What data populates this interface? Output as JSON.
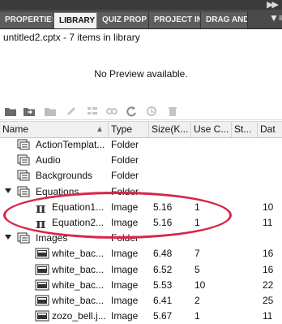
{
  "tabs": [
    {
      "label": "PROPERTIES",
      "active": false
    },
    {
      "label": "LIBRARY",
      "active": true
    },
    {
      "label": "QUIZ PROPERTIES",
      "active": false
    },
    {
      "label": "PROJECT INFO",
      "active": false
    },
    {
      "label": "DRAG AND DROP",
      "active": false
    }
  ],
  "tabs_display": [
    "PROPERTIES",
    "LIBRARY",
    "QUIZ PROP",
    "PROJECT IN",
    "DRAG AND"
  ],
  "info_line": "untitled2.cptx - 7 items in library",
  "preview_text": "No Preview available.",
  "columns": [
    "Name",
    "Type",
    "Size(K...",
    "Use C...",
    "St...",
    "Dat"
  ],
  "rows": [
    {
      "name": "ActionTemplat...",
      "type": "Folder",
      "size": "",
      "use": "",
      "st": "",
      "dat": "",
      "indent": 1,
      "icon": "folder-icon",
      "expanded": false
    },
    {
      "name": "Audio",
      "type": "Folder",
      "size": "",
      "use": "",
      "st": "",
      "dat": "",
      "indent": 1,
      "icon": "folder-icon",
      "expanded": false
    },
    {
      "name": "Backgrounds",
      "type": "Folder",
      "size": "",
      "use": "",
      "st": "",
      "dat": "",
      "indent": 1,
      "icon": "folder-icon",
      "expanded": false
    },
    {
      "name": "Equations",
      "type": "Folder",
      "size": "",
      "use": "",
      "st": "",
      "dat": "",
      "indent": 0,
      "icon": "folder-icon",
      "expanded": true
    },
    {
      "name": "Equation1...",
      "type": "Image",
      "size": "5.16",
      "use": "1",
      "st": "",
      "dat": "10",
      "indent": 2,
      "icon": "pi-icon"
    },
    {
      "name": "Equation2...",
      "type": "Image",
      "size": "5.16",
      "use": "1",
      "st": "",
      "dat": "11",
      "indent": 2,
      "icon": "pi-icon"
    },
    {
      "name": "Images",
      "type": "Folder",
      "size": "",
      "use": "",
      "st": "",
      "dat": "",
      "indent": 0,
      "icon": "folder-icon",
      "expanded": true
    },
    {
      "name": "white_bac...",
      "type": "Image",
      "size": "6.48",
      "use": "7",
      "st": "",
      "dat": "16",
      "indent": 2,
      "icon": "image-icon"
    },
    {
      "name": "white_bac...",
      "type": "Image",
      "size": "6.52",
      "use": "5",
      "st": "",
      "dat": "16",
      "indent": 2,
      "icon": "image-icon"
    },
    {
      "name": "white_bac...",
      "type": "Image",
      "size": "5.53",
      "use": "10",
      "st": "",
      "dat": "22",
      "indent": 2,
      "icon": "image-icon"
    },
    {
      "name": "white_bac...",
      "type": "Image",
      "size": "6.41",
      "use": "2",
      "st": "",
      "dat": "25",
      "indent": 2,
      "icon": "image-icon"
    },
    {
      "name": "zozo_bell.j...",
      "type": "Image",
      "size": "5.67",
      "use": "1",
      "st": "",
      "dat": "11",
      "indent": 2,
      "icon": "image-icon"
    }
  ],
  "toolbar_icons": [
    "new-folder-icon",
    "import-icon",
    "export-icon",
    "edit-icon",
    "properties-icon",
    "usage-icon",
    "update-icon",
    "select-unused-icon",
    "delete-icon"
  ],
  "colors": {
    "accent": "#d9244e",
    "tabbar": "#4a4a4a",
    "header": "#f0f0f0"
  }
}
